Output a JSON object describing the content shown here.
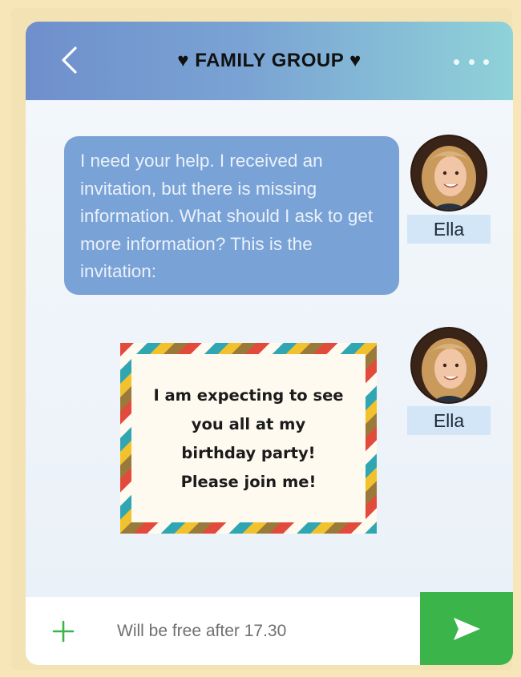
{
  "header": {
    "title": "♥ FAMILY GROUP ♥"
  },
  "messages": [
    {
      "sender": "Ella",
      "text": "I need your help. I received an invitation, but there is missing information. What should I ask to get more information? This is the invitation:"
    },
    {
      "sender": "Ella",
      "invitation_text": "I am expecting to see you all at my birthday party! Please join me!"
    }
  ],
  "composer": {
    "value": "Will be free after 17.30"
  },
  "colors": {
    "header_start": "#6f8fcc",
    "header_end": "#8fd2d8",
    "bubble": "#79a2d6",
    "send": "#3bb54a",
    "plus": "#3bb54a"
  },
  "icons": {
    "back": "chevron-left-icon",
    "more": "more-dots-icon",
    "add": "plus-icon",
    "send": "send-icon"
  }
}
